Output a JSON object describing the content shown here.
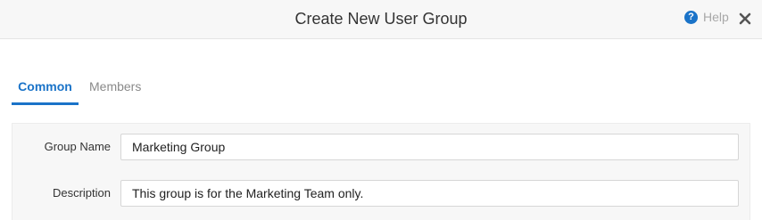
{
  "dialog": {
    "title": "Create New User Group",
    "help_label": "Help",
    "help_icon": "question-circle-icon",
    "close_icon": "close-icon"
  },
  "tabs": [
    {
      "label": "Common",
      "active": true
    },
    {
      "label": "Members",
      "active": false
    }
  ],
  "form": {
    "fields": [
      {
        "label": "Group Name",
        "value": "Marketing Group"
      },
      {
        "label": "Description",
        "value": "This group is for the Marketing Team only."
      }
    ]
  },
  "colors": {
    "accent": "#1a73c8",
    "header_bg": "#f7f7f7"
  }
}
